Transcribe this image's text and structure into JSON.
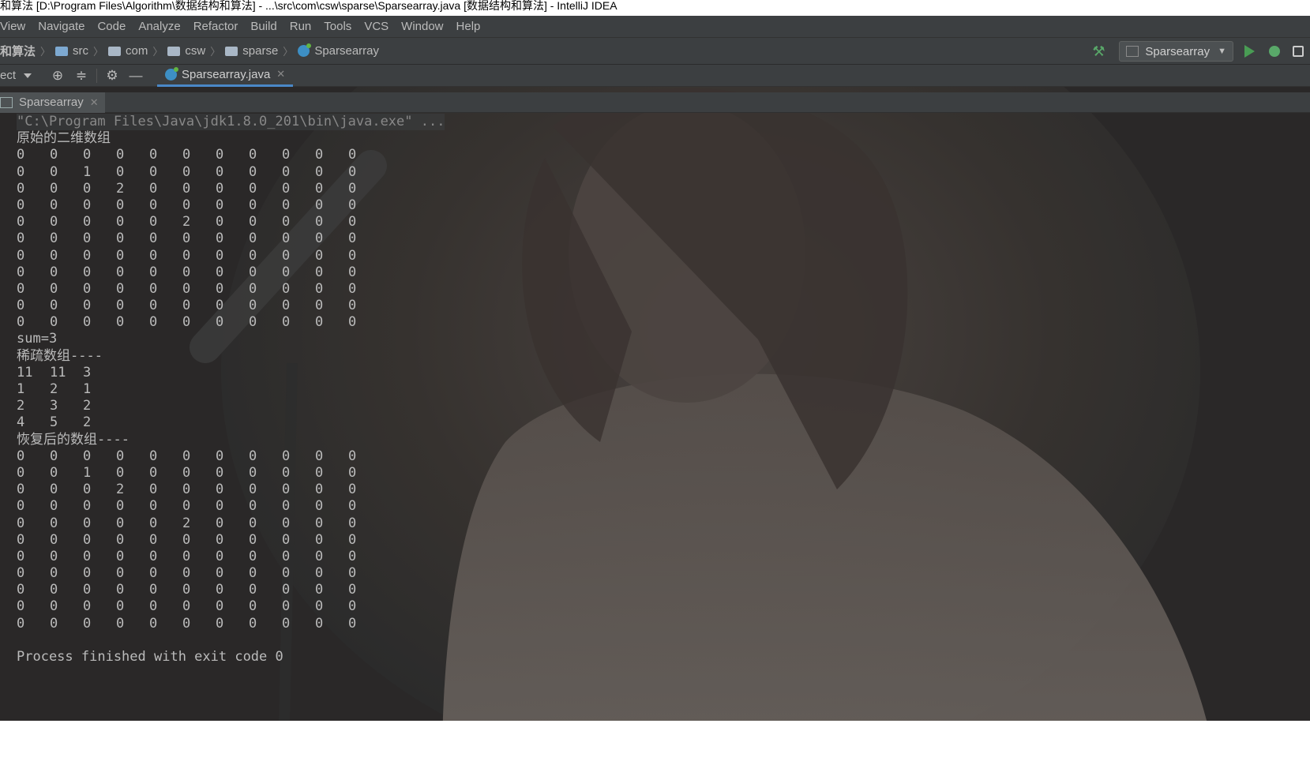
{
  "window": {
    "title": "和算法 [D:\\Program Files\\Algorithm\\数据结构和算法] - ...\\src\\com\\csw\\sparse\\Sparsearray.java [数据结构和算法] - IntelliJ IDEA"
  },
  "menu": [
    "View",
    "Navigate",
    "Code",
    "Analyze",
    "Refactor",
    "Build",
    "Run",
    "Tools",
    "VCS",
    "Window",
    "Help"
  ],
  "breadcrumbs": {
    "root": "和算法",
    "items": [
      "src",
      "com",
      "csw",
      "sparse"
    ],
    "class": "Sparsearray"
  },
  "toolbar": {
    "run_config": "Sparsearray"
  },
  "project_panel": {
    "label": "ect"
  },
  "editor_tab": {
    "label": "Sparsearray.java"
  },
  "run_tab": {
    "label": "Sparsearray"
  },
  "console": {
    "cmd": "\"C:\\Program Files\\Java\\jdk1.8.0_201\\bin\\java.exe\" ...",
    "original_title": "原始的二维数组",
    "original_array": [
      [
        "0",
        "0",
        "0",
        "0",
        "0",
        "0",
        "0",
        "0",
        "0",
        "0",
        "0"
      ],
      [
        "0",
        "0",
        "1",
        "0",
        "0",
        "0",
        "0",
        "0",
        "0",
        "0",
        "0"
      ],
      [
        "0",
        "0",
        "0",
        "2",
        "0",
        "0",
        "0",
        "0",
        "0",
        "0",
        "0"
      ],
      [
        "0",
        "0",
        "0",
        "0",
        "0",
        "0",
        "0",
        "0",
        "0",
        "0",
        "0"
      ],
      [
        "0",
        "0",
        "0",
        "0",
        "0",
        "2",
        "0",
        "0",
        "0",
        "0",
        "0"
      ],
      [
        "0",
        "0",
        "0",
        "0",
        "0",
        "0",
        "0",
        "0",
        "0",
        "0",
        "0"
      ],
      [
        "0",
        "0",
        "0",
        "0",
        "0",
        "0",
        "0",
        "0",
        "0",
        "0",
        "0"
      ],
      [
        "0",
        "0",
        "0",
        "0",
        "0",
        "0",
        "0",
        "0",
        "0",
        "0",
        "0"
      ],
      [
        "0",
        "0",
        "0",
        "0",
        "0",
        "0",
        "0",
        "0",
        "0",
        "0",
        "0"
      ],
      [
        "0",
        "0",
        "0",
        "0",
        "0",
        "0",
        "0",
        "0",
        "0",
        "0",
        "0"
      ],
      [
        "0",
        "0",
        "0",
        "0",
        "0",
        "0",
        "0",
        "0",
        "0",
        "0",
        "0"
      ]
    ],
    "sum_line": "sum=3",
    "sparse_title": "稀疏数组----",
    "sparse_array": [
      [
        "11",
        "11",
        "3"
      ],
      [
        "1",
        "2",
        "1"
      ],
      [
        "2",
        "3",
        "2"
      ],
      [
        "4",
        "5",
        "2"
      ]
    ],
    "restored_title": "恢复后的数组----",
    "restored_array": [
      [
        "0",
        "0",
        "0",
        "0",
        "0",
        "0",
        "0",
        "0",
        "0",
        "0",
        "0"
      ],
      [
        "0",
        "0",
        "1",
        "0",
        "0",
        "0",
        "0",
        "0",
        "0",
        "0",
        "0"
      ],
      [
        "0",
        "0",
        "0",
        "2",
        "0",
        "0",
        "0",
        "0",
        "0",
        "0",
        "0"
      ],
      [
        "0",
        "0",
        "0",
        "0",
        "0",
        "0",
        "0",
        "0",
        "0",
        "0",
        "0"
      ],
      [
        "0",
        "0",
        "0",
        "0",
        "0",
        "2",
        "0",
        "0",
        "0",
        "0",
        "0"
      ],
      [
        "0",
        "0",
        "0",
        "0",
        "0",
        "0",
        "0",
        "0",
        "0",
        "0",
        "0"
      ],
      [
        "0",
        "0",
        "0",
        "0",
        "0",
        "0",
        "0",
        "0",
        "0",
        "0",
        "0"
      ],
      [
        "0",
        "0",
        "0",
        "0",
        "0",
        "0",
        "0",
        "0",
        "0",
        "0",
        "0"
      ],
      [
        "0",
        "0",
        "0",
        "0",
        "0",
        "0",
        "0",
        "0",
        "0",
        "0",
        "0"
      ],
      [
        "0",
        "0",
        "0",
        "0",
        "0",
        "0",
        "0",
        "0",
        "0",
        "0",
        "0"
      ],
      [
        "0",
        "0",
        "0",
        "0",
        "0",
        "0",
        "0",
        "0",
        "0",
        "0",
        "0"
      ]
    ],
    "exit_line": "Process finished with exit code 0"
  },
  "icons": {
    "breadcrumb_folder": "folder-icon",
    "breadcrumb_class": "java-class-icon",
    "build": "hammer-icon",
    "run": "run-icon",
    "debug": "debug-icon",
    "coverage": "coverage-icon",
    "locate": "crosshair-icon",
    "collapse": "collapse-icon",
    "settings": "gear-icon",
    "hide": "minus-icon"
  },
  "colors": {
    "background": "#2b2b2b",
    "chrome": "#3c3f41",
    "console_text": "#bbbbbb",
    "active_tab_underline": "#4a88c7",
    "run_green": "#499c54"
  }
}
